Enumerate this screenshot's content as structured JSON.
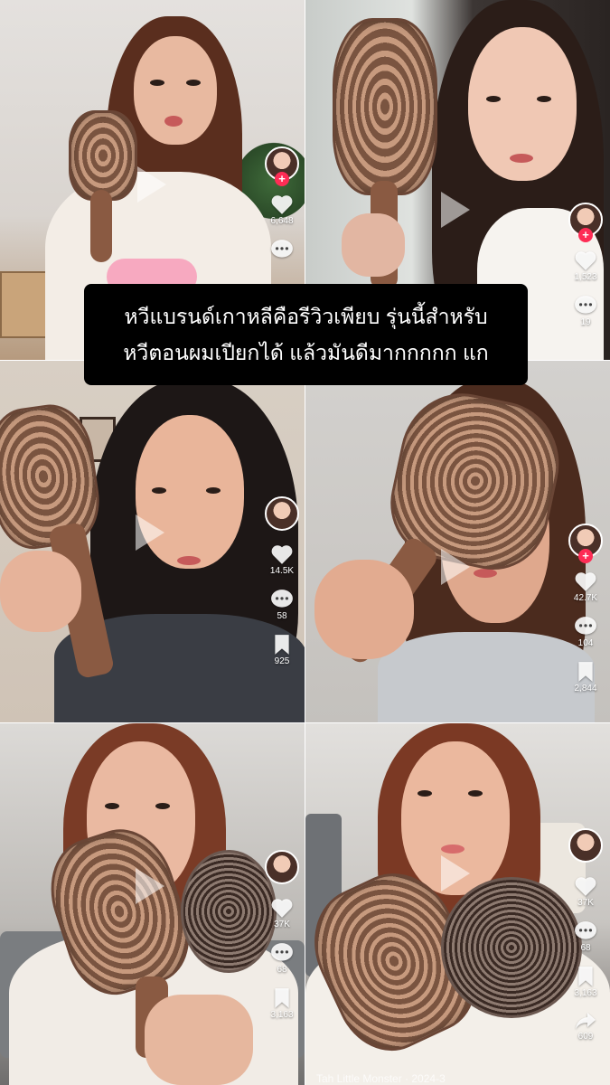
{
  "caption": {
    "line1": "หวีแบรนด์เกาหลีคือรีวิวเพียบ รุ่นนี้สำหรับ",
    "line2": "หวีตอนผมเปียกได้ แล้วมันดีมากกกกก แก"
  },
  "videos": [
    {
      "likes": "6,648",
      "comments": "",
      "saves": ""
    },
    {
      "likes": "1,523",
      "comments": "19",
      "saves": ""
    },
    {
      "likes": "14.5K",
      "comments": "58",
      "saves": "925"
    },
    {
      "likes": "42.7K",
      "comments": "104",
      "saves": "2,844"
    },
    {
      "likes": "37K",
      "comments": "68",
      "saves": "3,163"
    },
    {
      "likes": "37K",
      "comments": "68",
      "saves": "3,163",
      "shares": "609"
    }
  ],
  "bottom_label": "Tah Little Monster · 2024-3",
  "colors": {
    "follow": "#fe2c55",
    "caption_bg": "#000000"
  }
}
